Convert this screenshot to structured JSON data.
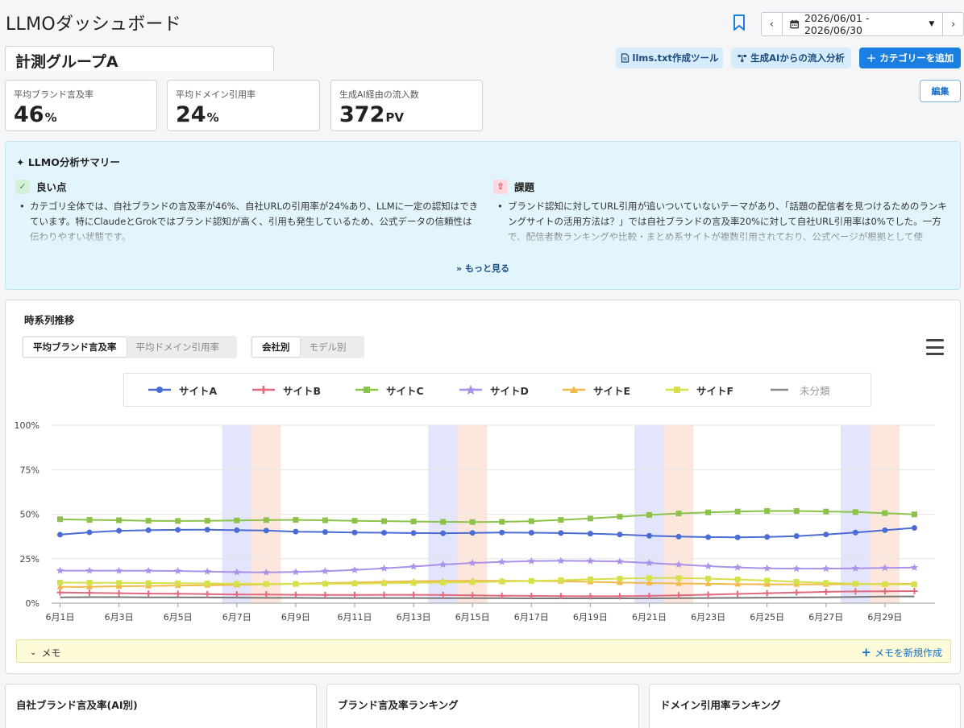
{
  "header": {
    "title": "LLMOダッシュボード",
    "date_range": "2026/06/01 - 2026/06/30",
    "prev_label": "‹",
    "next_label": "›"
  },
  "group": {
    "name": "計測グループA"
  },
  "actions": {
    "llms_tool": "llms.txt作成ツール",
    "ai_inflow": "生成AIからの流入分析",
    "add_category": "カテゴリーを追加",
    "edit": "編集"
  },
  "metrics": [
    {
      "label": "平均ブランド言及率",
      "value": "46",
      "unit": "%"
    },
    {
      "label": "平均ドメイン引用率",
      "value": "24",
      "unit": "%"
    },
    {
      "label": "生成AI経由の流入数",
      "value": "372",
      "unit": "PV"
    }
  ],
  "summary": {
    "title": "LLMO分析サマリー",
    "good_title": "良い点",
    "good_text": "カテゴリ全体では、自社ブランドの言及率が46%、自社URLの引用率が24%あり、LLMに一定の認知はできています。特にClaudeとGrokではブランド認知が高く、引用も発生しているため、公式データの信頼性は伝わりやすい状態です。",
    "issue_title": "課題",
    "issue_text": "ブランド認知に対してURL引用が追いついていないテーマがあり、「話題の配信者を見つけるためのランキングサイトの活用方法は？」では自社ブランドの言及率20%に対して自社URL引用率は0%でした。一方で、配信者数ランキングや比較・まとめ系サイトが複数引用されており、公式ページが根拠として使",
    "more": "もっと見る"
  },
  "chart_panel": {
    "title": "時系列推移",
    "metric_tabs": [
      "平均ブランド言及率",
      "平均ドメイン引用率"
    ],
    "group_tabs": [
      "会社別",
      "モデル別"
    ],
    "memo_label": "メモ",
    "memo_new": "メモを新規作成"
  },
  "chart_data": {
    "type": "line",
    "x": [
      "6月1日",
      "6月2日",
      "6月3日",
      "6月4日",
      "6月5日",
      "6月6日",
      "6月7日",
      "6月8日",
      "6月9日",
      "6月10日",
      "6月11日",
      "6月12日",
      "6月13日",
      "6月14日",
      "6月15日",
      "6月16日",
      "6月17日",
      "6月18日",
      "6月19日",
      "6月20日",
      "6月21日",
      "6月22日",
      "6月23日",
      "6月24日",
      "6月25日",
      "6月26日",
      "6月27日",
      "6月28日",
      "6月29日",
      "6月30日"
    ],
    "tick_labels": [
      "6月1日",
      "6月3日",
      "6月5日",
      "6月7日",
      "6月9日",
      "6月11日",
      "6月13日",
      "6月15日",
      "6月17日",
      "6月19日",
      "6月21日",
      "6月23日",
      "6月25日",
      "6月27日",
      "6月29日"
    ],
    "y_ticks": [
      "0%",
      "25%",
      "50%",
      "75%",
      "100%"
    ],
    "ylim": [
      0,
      100
    ],
    "grid": true,
    "legend_position": "top",
    "weekend_bands": [
      [
        6,
        7
      ],
      [
        13,
        14
      ],
      [
        20,
        21
      ],
      [
        27,
        28
      ]
    ],
    "band_colors": [
      "#dde1fa",
      "#fde3d6"
    ],
    "series": [
      {
        "name": "サイトA",
        "color": "#4a6cd4",
        "marker": "circle",
        "values": [
          38.5,
          39.8,
          40.7,
          41,
          41.2,
          41.3,
          41,
          40.8,
          40.2,
          40,
          39.7,
          39.6,
          39.4,
          39.3,
          39.5,
          39.7,
          39.6,
          39.4,
          39.1,
          38.6,
          37.9,
          37.4,
          37.1,
          37,
          37.2,
          37.7,
          38.6,
          39.7,
          41,
          42.3
        ]
      },
      {
        "name": "サイトB",
        "color": "#e06b7e",
        "marker": "plus",
        "values": [
          6,
          5.8,
          5.6,
          5.4,
          5.3,
          5.1,
          4.9,
          4.9,
          4.7,
          4.6,
          4.6,
          4.7,
          4.7,
          4.6,
          4.4,
          4.2,
          4.1,
          4,
          3.9,
          3.9,
          4.1,
          4.4,
          4.8,
          5.2,
          5.6,
          6,
          6.4,
          6.6,
          6.7,
          6.8
        ]
      },
      {
        "name": "サイトC",
        "color": "#8cc24a",
        "marker": "square",
        "values": [
          47.2,
          46.8,
          46.6,
          46.3,
          46.2,
          46.3,
          46.5,
          46.7,
          46.8,
          46.6,
          46.3,
          46.1,
          45.9,
          45.7,
          45.6,
          45.7,
          46.1,
          46.8,
          47.6,
          48.6,
          49.6,
          50.4,
          51,
          51.5,
          51.8,
          51.8,
          51.5,
          51.2,
          50.6,
          49.9
        ]
      },
      {
        "name": "サイトD",
        "color": "#a992e8",
        "marker": "star",
        "values": [
          18.3,
          18.3,
          18.2,
          18.2,
          18.1,
          17.8,
          17.4,
          17.3,
          17.5,
          18,
          18.7,
          19.6,
          20.6,
          21.7,
          22.6,
          23.2,
          23.6,
          23.8,
          23.7,
          23.4,
          22.6,
          21.7,
          20.8,
          20.1,
          19.6,
          19.4,
          19.4,
          19.6,
          19.8,
          20
        ]
      },
      {
        "name": "サイトE",
        "color": "#f0b94a",
        "marker": "triangle",
        "values": [
          9.2,
          9.2,
          9.5,
          9.7,
          9.9,
          10.1,
          10.3,
          10.6,
          10.9,
          11.3,
          11.6,
          12,
          12.3,
          12.5,
          12.6,
          12.6,
          12.5,
          12.3,
          12,
          11.6,
          11.3,
          11.1,
          10.9,
          10.7,
          10.6,
          10.6,
          10.6,
          10.7,
          10.8,
          10.9
        ]
      },
      {
        "name": "サイトF",
        "color": "#d6e04a",
        "marker": "square",
        "values": [
          11.6,
          11.5,
          11.4,
          11.3,
          11.2,
          11.1,
          10.9,
          10.8,
          10.8,
          10.9,
          11,
          11.2,
          11.4,
          11.6,
          11.8,
          12.1,
          12.5,
          12.9,
          13.4,
          13.8,
          14.1,
          14.1,
          13.8,
          13.3,
          12.7,
          12,
          11.4,
          10.9,
          10.6,
          10.5
        ]
      },
      {
        "name": "未分類",
        "color": "#777777",
        "marker": "none",
        "values": [
          3.3,
          3.4,
          3.4,
          3.3,
          3.3,
          3.2,
          3.1,
          3,
          3,
          2.9,
          2.9,
          2.9,
          2.9,
          2.8,
          2.8,
          2.8,
          2.7,
          2.7,
          2.7,
          2.7,
          2.7,
          2.8,
          2.9,
          3,
          3.1,
          3.2,
          3.3,
          3.5,
          3.7,
          3.8
        ]
      }
    ]
  },
  "bottom_cards": [
    {
      "title": "自社ブランド言及率(AI別)"
    },
    {
      "title": "ブランド言及率ランキング"
    },
    {
      "title": "ドメイン引用率ランキング"
    }
  ]
}
